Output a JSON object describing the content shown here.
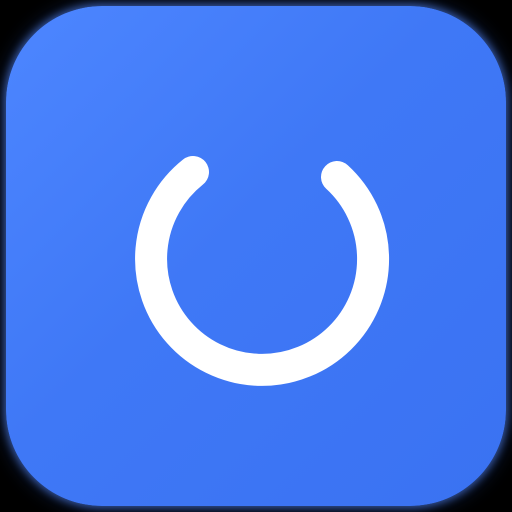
{
  "app_icon": {
    "icon_name": "power-ring-icon",
    "background_color": "#3f78f6",
    "gradient_start": "#4d86ff",
    "gradient_end": "#3a72f2",
    "glyph_color": "#ffffff",
    "background": "#000000"
  }
}
